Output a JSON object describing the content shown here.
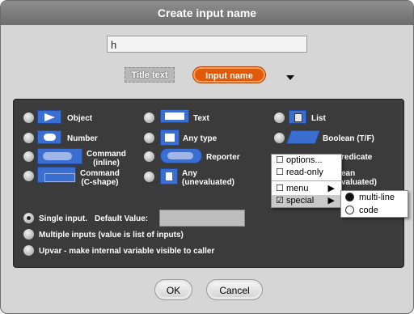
{
  "dialog": {
    "title": "Create input name"
  },
  "name_field": {
    "value": "h"
  },
  "preview": {
    "title_text": "Title text",
    "input_name": "Input name"
  },
  "types": [
    {
      "id": "object",
      "label": "Object"
    },
    {
      "id": "text",
      "label": "Text"
    },
    {
      "id": "list",
      "label": "List"
    },
    {
      "id": "number",
      "label": "Number"
    },
    {
      "id": "any-type",
      "label": "Any type"
    },
    {
      "id": "boolean",
      "label": "Boolean (T/F)"
    },
    {
      "id": "command-inline",
      "label": "Command\n(inline)"
    },
    {
      "id": "reporter",
      "label": "Reporter"
    },
    {
      "id": "predicate",
      "label": "redicate"
    },
    {
      "id": "command-c",
      "label": "Command\n(C-shape)"
    },
    {
      "id": "any-unevaluated",
      "label": "Any\n(unevaluated)"
    },
    {
      "id": "boolean-unevaluated",
      "label": "ean\nvaluated)"
    }
  ],
  "modes": {
    "single": "Single input.",
    "default_label": "Default Value:",
    "multiple": "Multiple inputs (value is list of inputs)",
    "upvar": "Upvar - make internal variable visible to caller"
  },
  "context_menu": {
    "items": [
      "options...",
      "read-only",
      "menu",
      "special"
    ],
    "checkbox_states": [
      "☐",
      "☐",
      "☐",
      "☑"
    ],
    "arrow": "▶"
  },
  "submenu": {
    "items": [
      "multi-line",
      "code"
    ],
    "selected": "multi-line"
  },
  "buttons": {
    "ok": "OK",
    "cancel": "Cancel"
  },
  "colors": {
    "accent": "#3a6fd1",
    "input_chip": "#e05a0a"
  }
}
